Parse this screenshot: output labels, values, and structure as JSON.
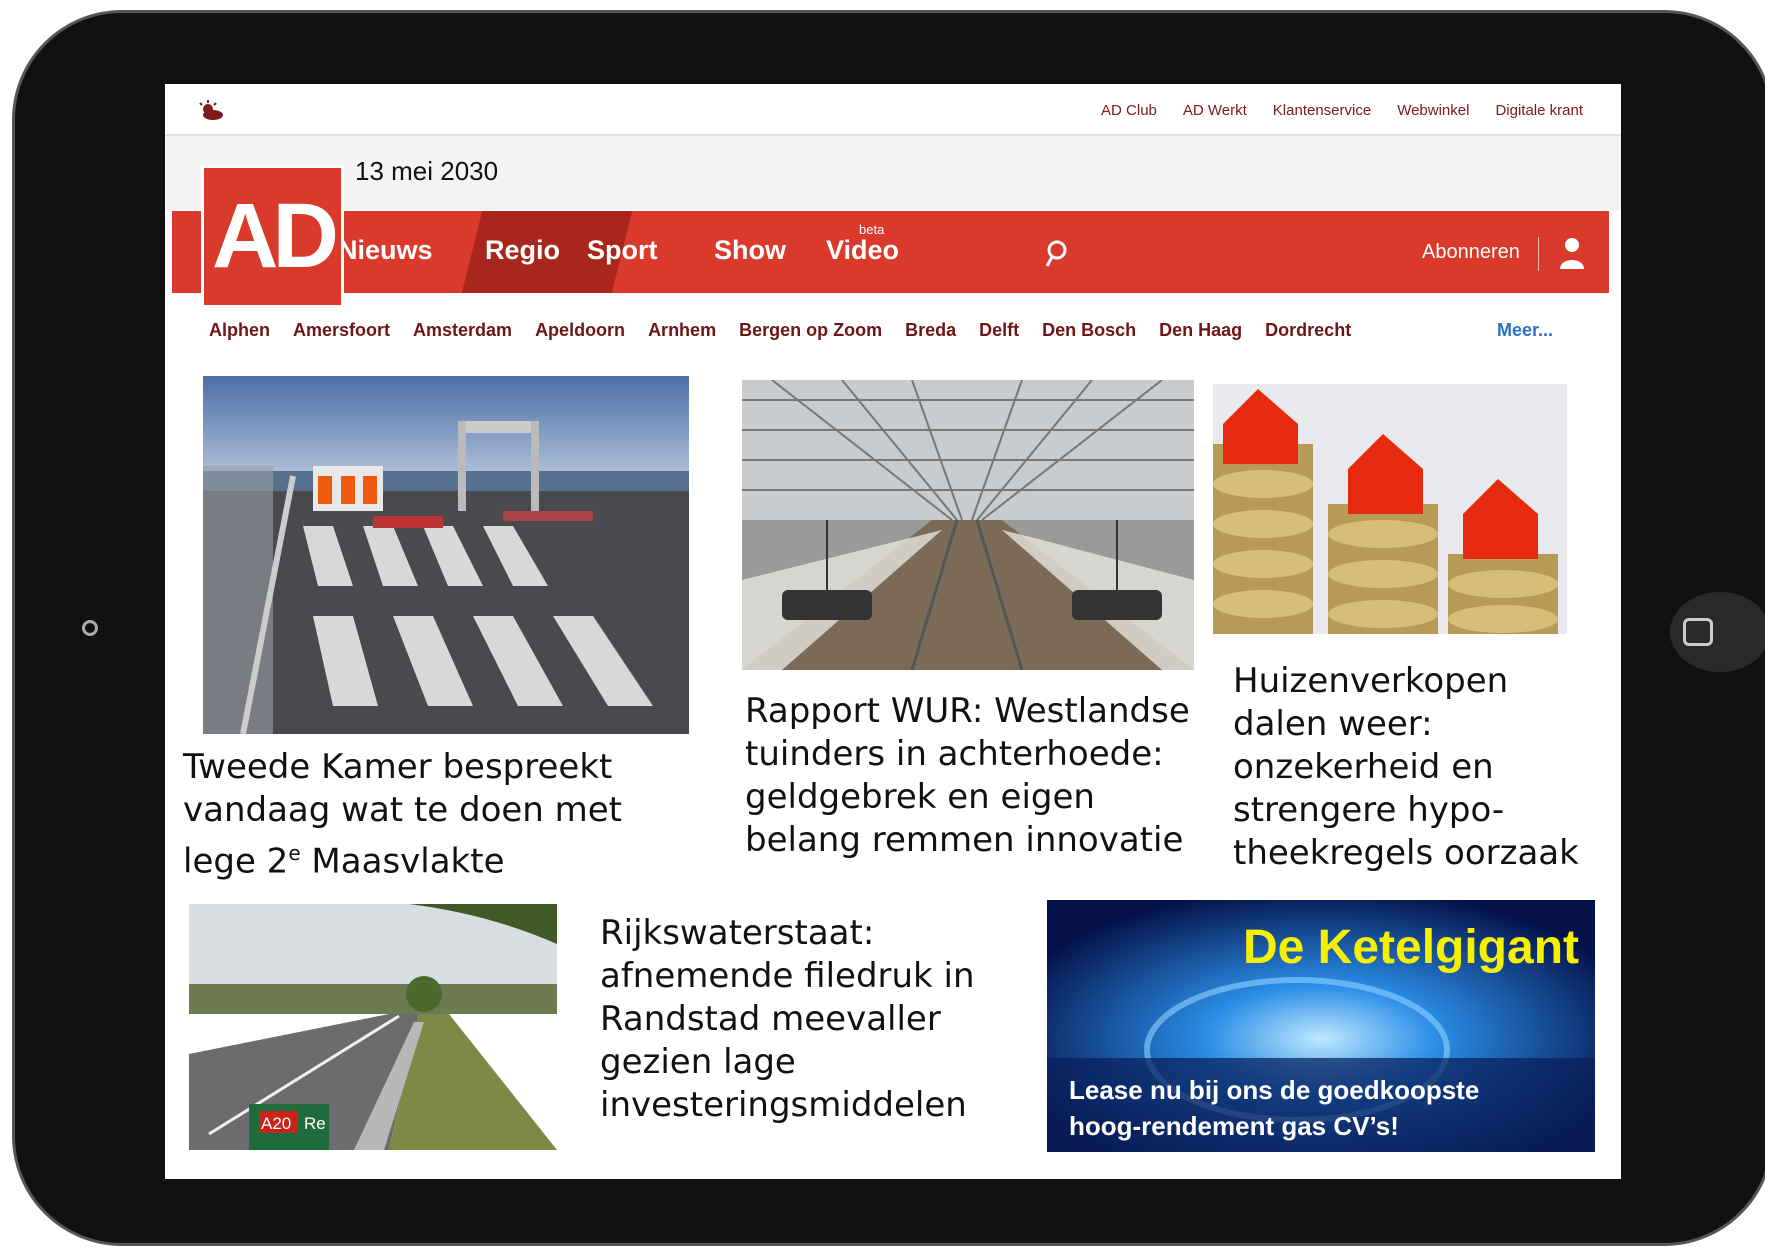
{
  "top_links": [
    "AD Club",
    "AD Werkt",
    "Klantenservice",
    "Webwinkel",
    "Digitale krant"
  ],
  "date": "13 mei 2030",
  "logo": "AD",
  "nav": {
    "items": [
      "Nieuws",
      "Regio",
      "Sport",
      "Show",
      "Video"
    ],
    "active": "Regio",
    "beta": "beta",
    "subscribe": "Abonneren"
  },
  "cities": [
    "Alphen",
    "Amersfoort",
    "Amsterdam",
    "Apeldoorn",
    "Arnhem",
    "Bergen op Zoom",
    "Breda",
    "Delft",
    "Den Bosch",
    "Den Haag",
    "Dordrecht"
  ],
  "more": "Meer...",
  "articles": [
    {
      "line1": "Tweede Kamer bespreekt",
      "line2": "vandaag wat te doen met",
      "line3a": "lege 2",
      "sup": "e",
      "line3b": " Maasvlakte"
    },
    {
      "lines": [
        "Rapport WUR: Westlandse",
        "tuinders in achterhoede:",
        "geldgebrek en eigen",
        "belang remmen innovatie"
      ]
    },
    {
      "lines": [
        "Huizenverkopen",
        "dalen weer:",
        "onzekerheid en",
        "strengere hypo-",
        "theekregels oorzaak"
      ]
    },
    {
      "lines": [
        "Rijkswaterstaat:",
        "afnemende filedruk in",
        "Randstad meevaller",
        "gezien lage",
        "investeringsmiddelen"
      ]
    }
  ],
  "road_sign": {
    "code": "A20",
    "text": "Re"
  },
  "ad": {
    "title": "De Ketelgigant",
    "text1": "Lease nu bij ons de goedkoopste",
    "text2": "hoog-rendement gas CV’s!"
  },
  "colors": {
    "brand_red": "#d93a2b",
    "active_red": "#a8261b",
    "link_blue": "#2a72c9",
    "ad_yellow": "#f5f000"
  }
}
